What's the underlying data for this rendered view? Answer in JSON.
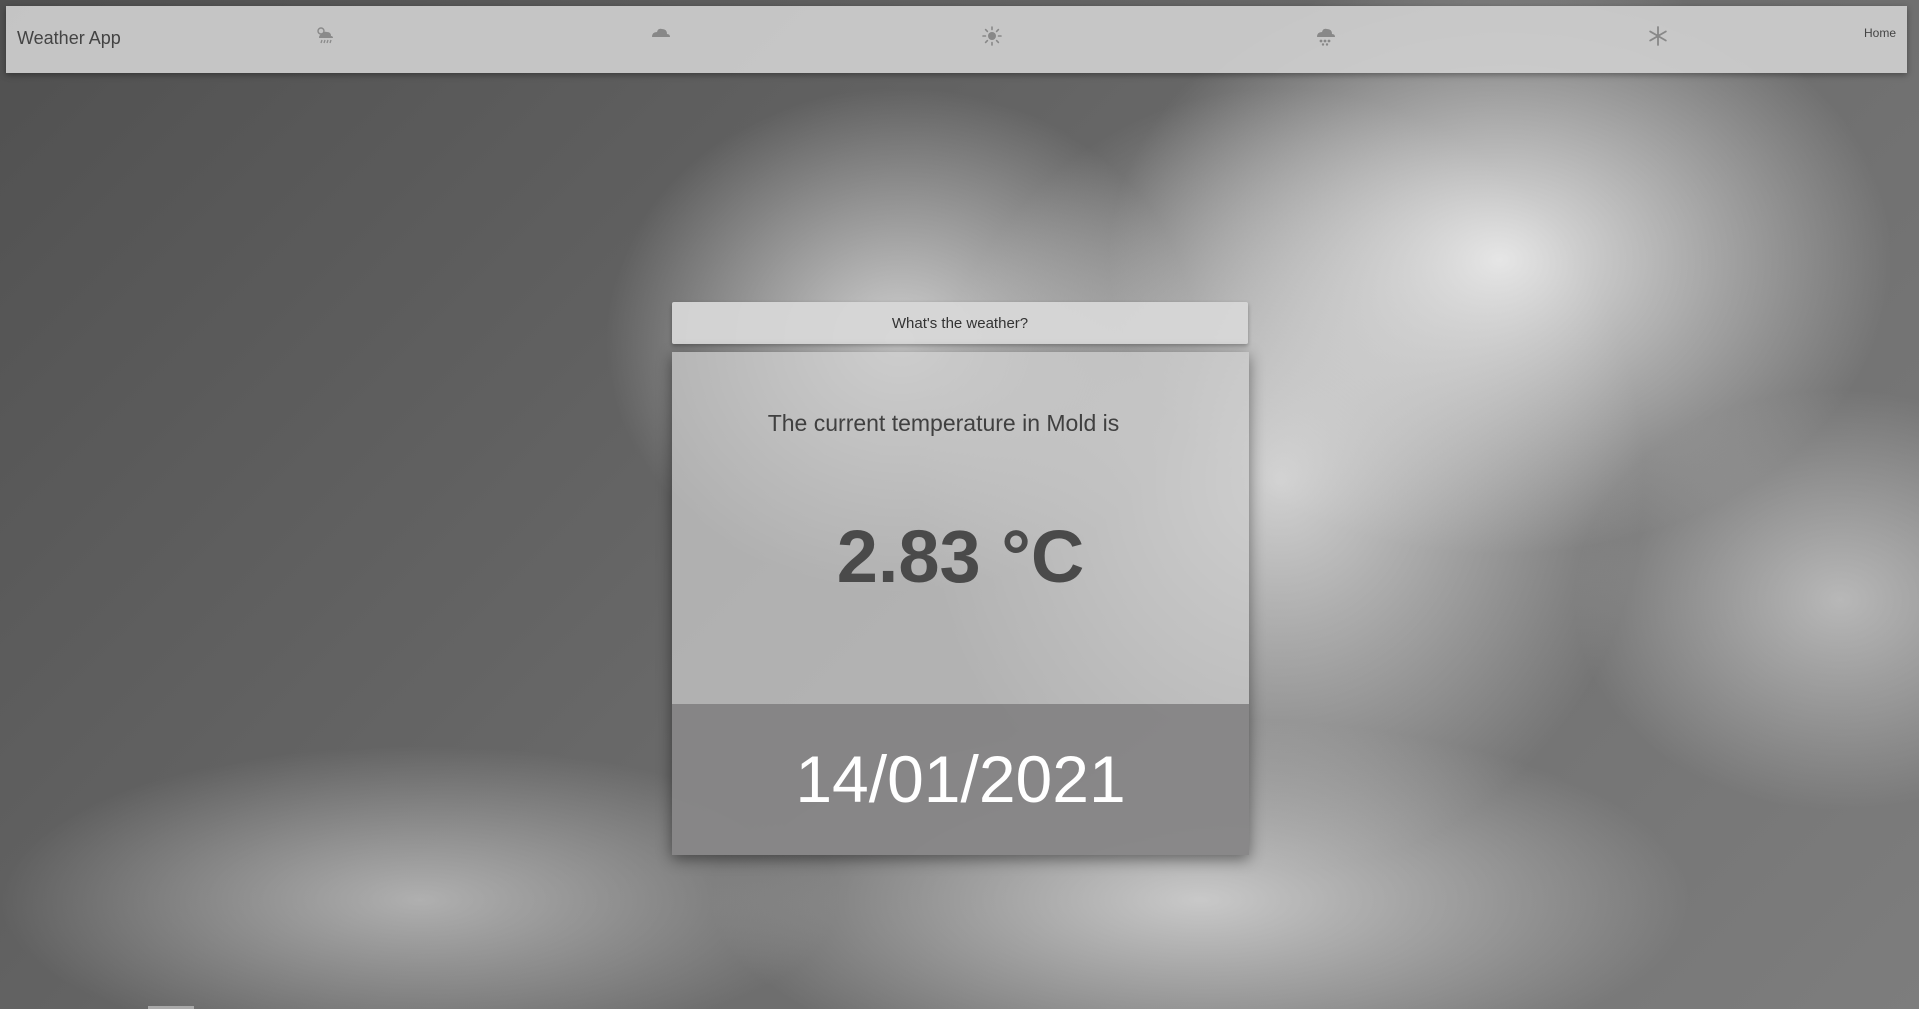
{
  "navbar": {
    "brand": "Weather App",
    "icons": [
      "rain-sun-icon",
      "cloud-icon",
      "sun-icon",
      "heavy-rain-icon",
      "snowflake-icon"
    ],
    "home_label": "Home"
  },
  "widget": {
    "ask_button_label": "What's the weather?",
    "temperature_label": "The current temperature in Mold is",
    "temperature_value": "2.83 °C",
    "date": "14/01/2021"
  },
  "colors": {
    "navbar_bg": "#cdcdcd",
    "card_bottom_bg": "#878687",
    "text_dark": "#404040"
  }
}
